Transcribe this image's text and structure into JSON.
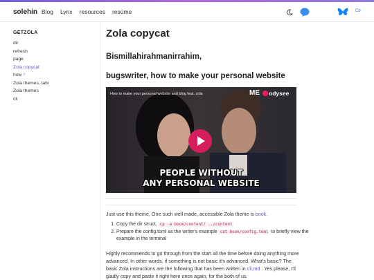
{
  "header": {
    "brand": "solehin",
    "nav": [
      "Blog",
      "Lynx",
      "resources",
      "resúme"
    ],
    "lang": "Cb",
    "icons": [
      "moon-icon",
      "chat-bubble-icon",
      "butterfly-icon"
    ]
  },
  "sidebar": {
    "title": "GETZOLA",
    "items": [
      {
        "label": "dir"
      },
      {
        "label": "refresh"
      },
      {
        "label": "page"
      },
      {
        "label": "Zola copycat",
        "active": true
      },
      {
        "label": "how",
        "suffix": "?"
      },
      {
        "label": "Zola themes, tabi"
      },
      {
        "label": "Zola themes"
      },
      {
        "label": "cli"
      }
    ]
  },
  "main": {
    "title": "Zola copycat",
    "h2a": "Bismillahirahmanirrahim,",
    "h2b": "bugswriter, how to make your personal website",
    "video": {
      "title": "How to make your personal website and blog feat. zola",
      "me": "ME",
      "brand": "odysee",
      "caption1": "PEOPLE WITHOUT",
      "caption2": "ANY PERSONAL WEBSITE"
    },
    "p1_pre": "Just use this theme, One such well made, accessible Zola theme is ",
    "p1_link": "book.",
    "list": [
      {
        "pre": "Copy the dir struct, ",
        "code": "cp -a book/content/ ../content",
        "post": ""
      },
      {
        "pre": "Prepare the config.toml as the writer's example ",
        "code": "cat book/config.toml",
        "post": " to briefly view the example in the terminal"
      }
    ],
    "p2_pre": "Highly recommends to go through from the start all the time before doing anything more advanced, In other words, if something is not basic it's advanced. What's basic? The basic Zola instructions are the following that has been written in ",
    "p2_link": "cli.md",
    "p2_post": " . Yes please, I'll gladly copy and paste it right here once again, for the both of us."
  },
  "colors": {
    "accent": "#6a4fd3",
    "play": "#d61d5e",
    "code": "#c2185b",
    "bluesky": "#1185fe"
  }
}
